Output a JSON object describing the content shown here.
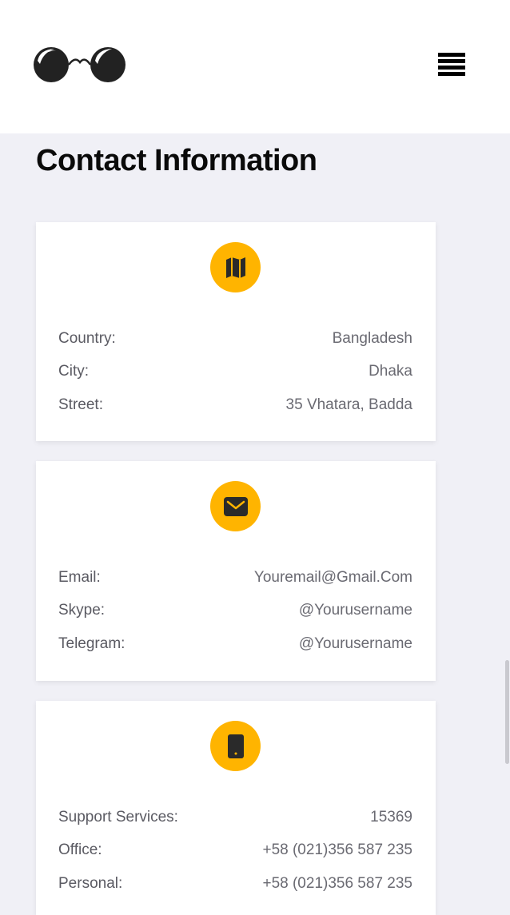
{
  "header": {
    "logo_icon": "glasses-logo-icon",
    "menu_icon": "hamburger-menu-icon"
  },
  "page": {
    "title": "Contact Information"
  },
  "cards": [
    {
      "icon": "map-icon",
      "rows": [
        {
          "label": "Country:",
          "value": "Bangladesh"
        },
        {
          "label": "City:",
          "value": "Dhaka"
        },
        {
          "label": "Street:",
          "value": "35 Vhatara, Badda"
        }
      ]
    },
    {
      "icon": "envelope-icon",
      "rows": [
        {
          "label": "Email:",
          "value": "Youremail@Gmail.Com"
        },
        {
          "label": "Skype:",
          "value": "@Yourusername"
        },
        {
          "label": "Telegram:",
          "value": "@Yourusername"
        }
      ]
    },
    {
      "icon": "mobile-phone-icon",
      "rows": [
        {
          "label": "Support Services:",
          "value": "15369"
        },
        {
          "label": "Office:",
          "value": "+58 (021)356 587 235"
        },
        {
          "label": "Personal:",
          "value": "+58 (021)356 587 235"
        }
      ]
    }
  ],
  "colors": {
    "accent": "#ffb400",
    "background": "#f0f0f6",
    "card": "#ffffff",
    "text": "#666670"
  }
}
